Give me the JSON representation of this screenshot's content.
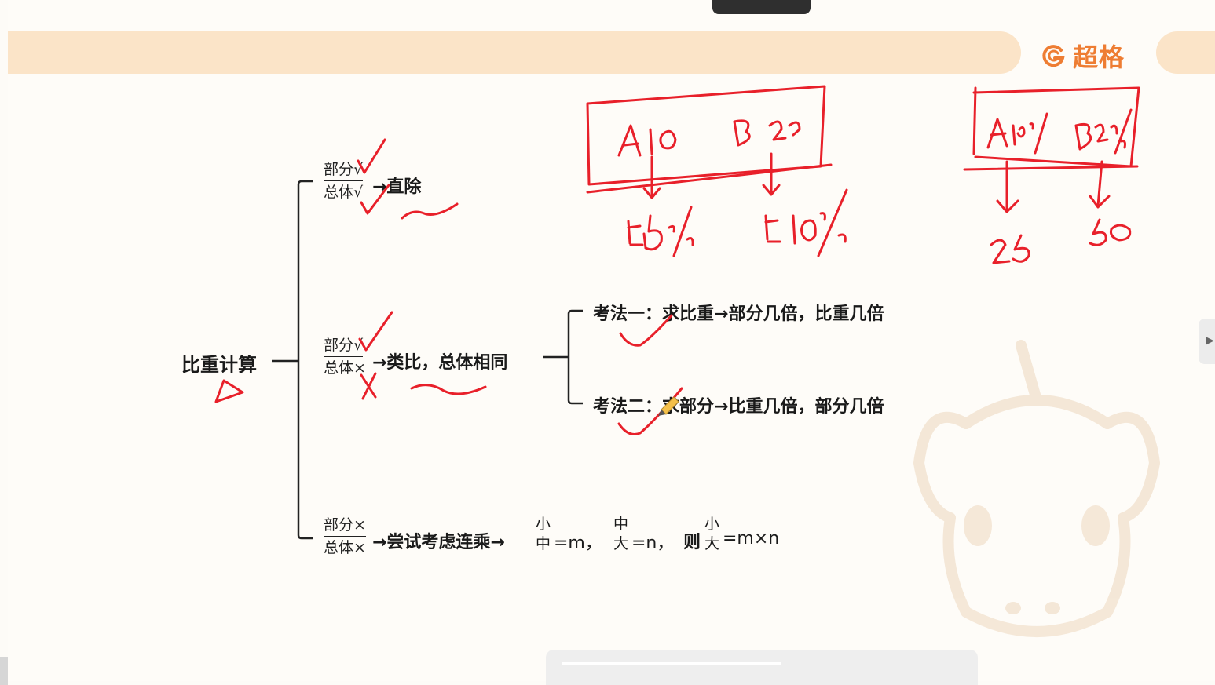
{
  "brand": {
    "logo_text": "超格",
    "accent": "#ee7d33",
    "banner_color": "#fbe4c8"
  },
  "mindmap": {
    "root_label": "比重计算",
    "branch1": {
      "frac_top": "部分√",
      "frac_bottom": "总体√",
      "result": "→直除"
    },
    "branch2": {
      "frac_top": "部分√",
      "frac_bottom": "总体×",
      "result": "→类比，总体相同",
      "method1": {
        "prefix": "考法一：",
        "text": "求比重→部分几倍，比重几倍"
      },
      "method2": {
        "prefix": "考法二：",
        "text": "求部分→比重几倍，部分几倍"
      }
    },
    "branch3": {
      "frac_top": "部分×",
      "frac_bottom": "总体×",
      "result": "→尝试考虑连乘→",
      "f1_num": "小",
      "f1_den": "中",
      "f1_eq": "=m，",
      "f2_num": "中",
      "f2_den": "大",
      "f2_eq": "=n，",
      "then": "则",
      "f3_num": "小",
      "f3_den": "大",
      "f3_eq": "=m×n"
    }
  },
  "annotations": {
    "ink_color": "#e8202a"
  },
  "controls": {
    "side_handle_icon": "play-right-icon"
  }
}
